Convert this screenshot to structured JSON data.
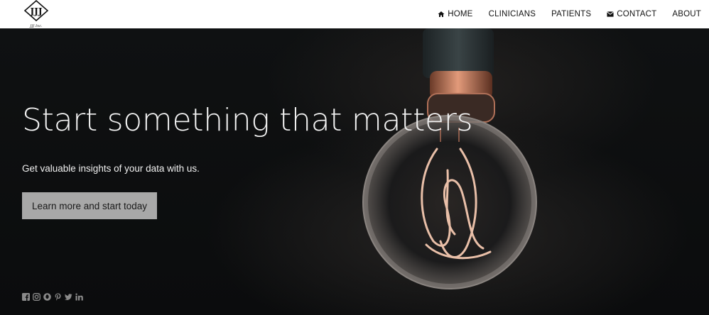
{
  "brand": {
    "logo_letters": "JJJ",
    "logo_caption": "JJJ Inc."
  },
  "nav": {
    "items": [
      {
        "label": "HOME",
        "icon": "home-icon"
      },
      {
        "label": "CLINICIANS",
        "icon": ""
      },
      {
        "label": "PATIENTS",
        "icon": ""
      },
      {
        "label": "CONTACT",
        "icon": "envelope-icon"
      },
      {
        "label": "ABOUT",
        "icon": ""
      }
    ]
  },
  "hero": {
    "headline": "Start something that matters",
    "subline": "Get valuable insights of your data with us.",
    "cta_label": "Learn more and start today",
    "background": "lightbulb-photo"
  },
  "social": [
    "facebook-icon",
    "instagram-icon",
    "snapchat-icon",
    "pinterest-icon",
    "twitter-icon",
    "linkedin-icon"
  ],
  "colors": {
    "nav_bg": "#ffffff",
    "hero_bg": "#0c0d0e",
    "cta_bg": "#a8a8a8",
    "text_light": "#f2f2f2",
    "social": "#8a8a8a"
  }
}
